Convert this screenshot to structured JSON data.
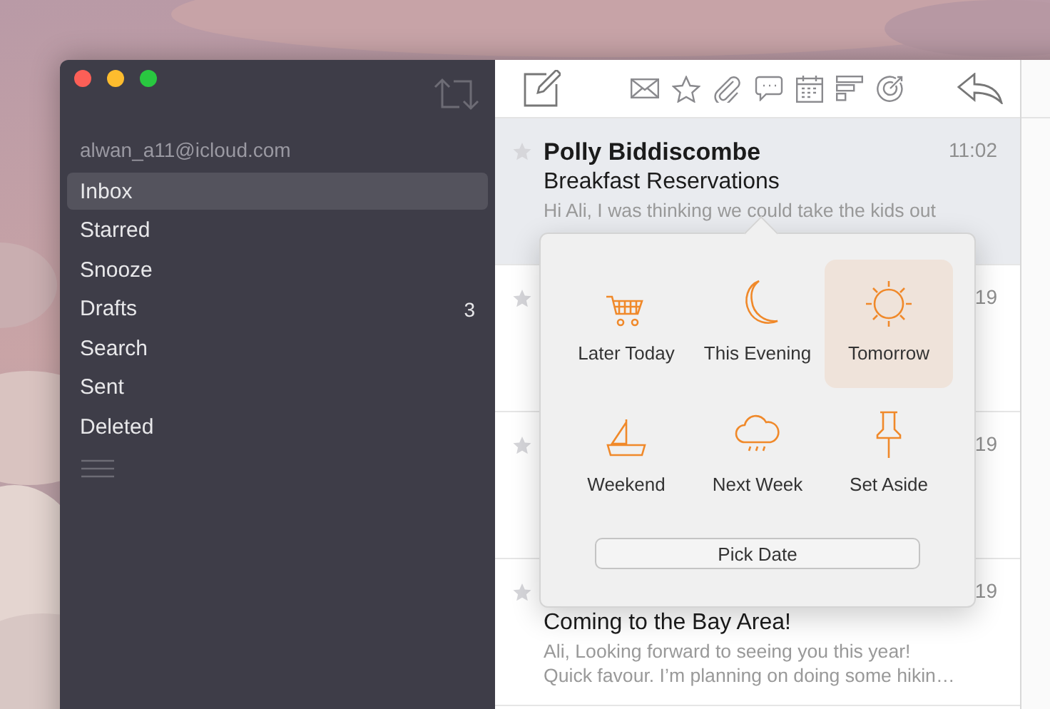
{
  "sidebar": {
    "account": "alwan_a11@icloud.com",
    "items": [
      {
        "label": "Inbox",
        "selected": true
      },
      {
        "label": "Starred",
        "selected": false
      },
      {
        "label": "Snooze",
        "selected": false
      },
      {
        "label": "Drafts",
        "selected": false,
        "count": "3"
      },
      {
        "label": "Search",
        "selected": false
      },
      {
        "label": "Sent",
        "selected": false
      },
      {
        "label": "Deleted",
        "selected": false
      }
    ]
  },
  "messages": [
    {
      "sender": "Polly Biddiscombe",
      "time": "11:02",
      "subject": "Breakfast Reservations",
      "preview_lines": [
        "Hi Ali, I was thinking we could take the kids out"
      ],
      "selected": true
    },
    {
      "time": "19",
      "selected": false
    },
    {
      "time": "19",
      "selected": false
    },
    {
      "time": "19",
      "subject": "Coming to the Bay Area!",
      "preview_lines": [
        "Ali, Looking forward to seeing you this year!",
        "Quick favour. I’m planning on doing some hikin…"
      ],
      "selected": false
    }
  ],
  "snooze_popover": {
    "options": [
      {
        "label": "Later Today",
        "selected": false
      },
      {
        "label": "This Evening",
        "selected": false
      },
      {
        "label": "Tomorrow",
        "selected": true
      },
      {
        "label": "Weekend",
        "selected": false
      },
      {
        "label": "Next Week",
        "selected": false
      },
      {
        "label": "Set Aside",
        "selected": false
      }
    ],
    "button": "Pick Date"
  }
}
